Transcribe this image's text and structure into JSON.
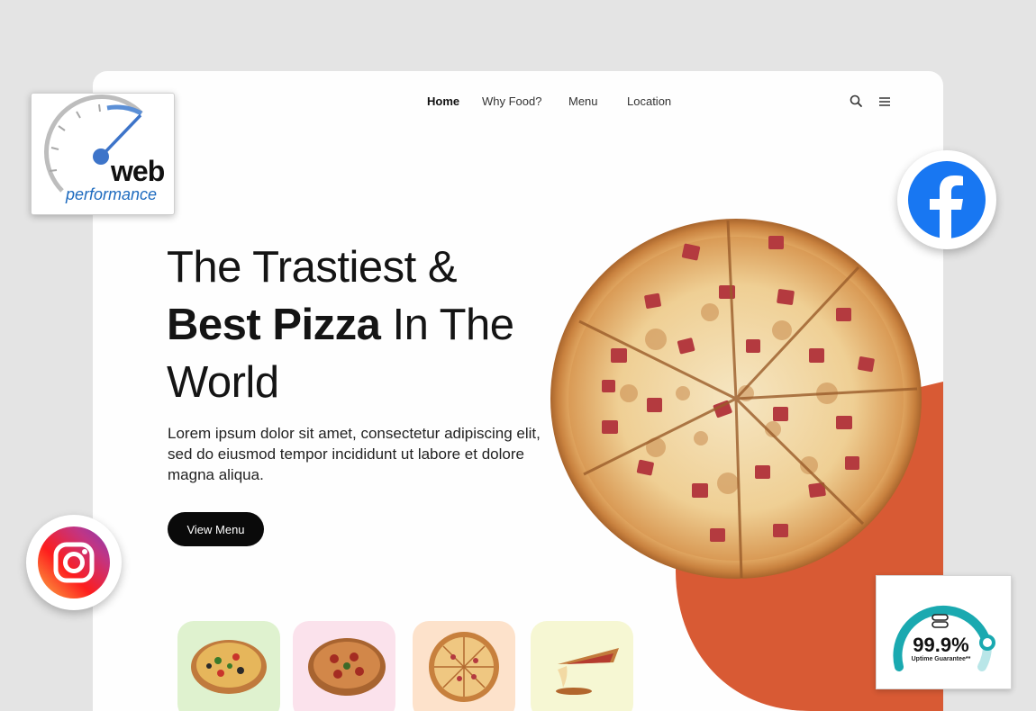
{
  "nav": {
    "items": [
      "Home",
      "Why Food?",
      "Menu",
      "Location"
    ],
    "active": "Home"
  },
  "hero": {
    "title_line1": "The  Trastiest &",
    "title_bold": "Best Pizza",
    "title_line2_rest": " In The",
    "title_line3": "World",
    "description": "Lorem ipsum dolor sit amet, consectetur adipiscing elit, sed do eiusmod tempor incididunt ut labore et dolore magna aliqua.",
    "cta_label": "View Menu"
  },
  "badges": {
    "web_word": "web",
    "performance_word": "performance",
    "uptime_value": "99.9%",
    "uptime_label": "Uptime Guarantee**"
  },
  "colors": {
    "accent_orange": "#d85a34",
    "button_black": "#0a0a0a",
    "facebook_blue": "#1877f2",
    "uptime_teal": "#1aa9b0"
  },
  "icons": [
    "search-icon",
    "hamburger-menu-icon",
    "speedometer-icon",
    "facebook-icon",
    "instagram-icon",
    "server-icon"
  ]
}
